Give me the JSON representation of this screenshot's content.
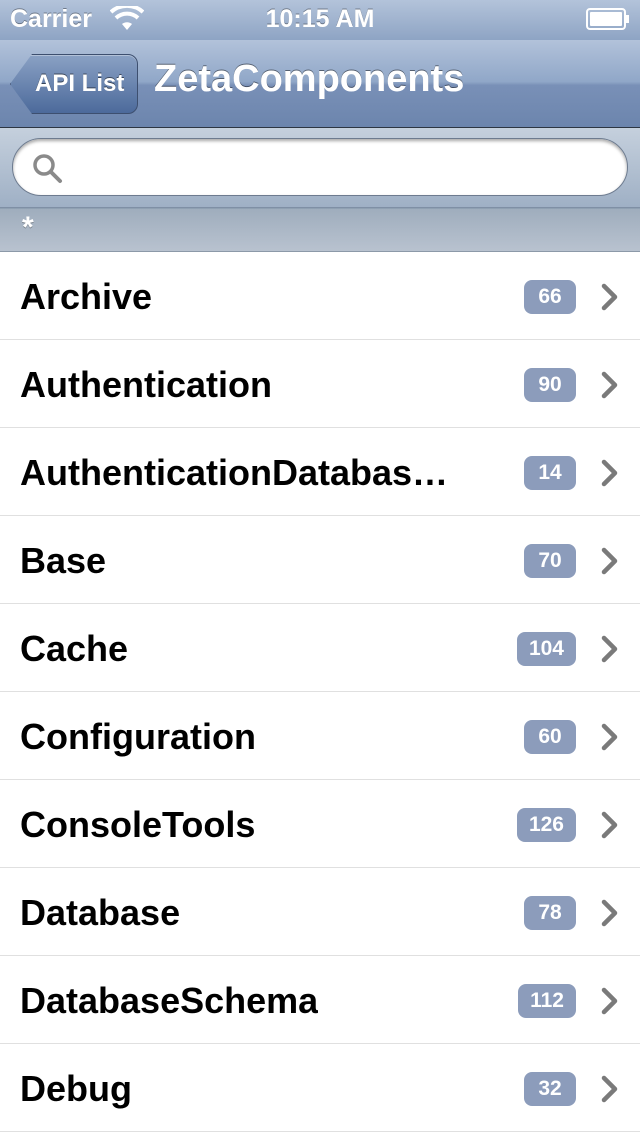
{
  "status_bar": {
    "carrier": "Carrier",
    "time": "10:15 AM"
  },
  "nav": {
    "back_label": "API List",
    "title": "ZetaComponents"
  },
  "search": {
    "value": "",
    "placeholder": ""
  },
  "section": {
    "header": "*"
  },
  "rows": [
    {
      "label": "Archive",
      "count": "66"
    },
    {
      "label": "Authentication",
      "count": "90"
    },
    {
      "label": "AuthenticationDatabas…",
      "count": "14"
    },
    {
      "label": "Base",
      "count": "70"
    },
    {
      "label": "Cache",
      "count": "104"
    },
    {
      "label": "Configuration",
      "count": "60"
    },
    {
      "label": "ConsoleTools",
      "count": "126"
    },
    {
      "label": "Database",
      "count": "78"
    },
    {
      "label": "DatabaseSchema",
      "count": "112"
    },
    {
      "label": "Debug",
      "count": "32"
    }
  ],
  "colors": {
    "nav_bar": "#7990b7",
    "badge": "#8c9cbb",
    "chevron": "#7a7a7a"
  },
  "icons": {
    "wifi": "wifi-icon",
    "battery": "battery-icon",
    "search": "search-icon",
    "chevron": "chevron-right-icon"
  }
}
